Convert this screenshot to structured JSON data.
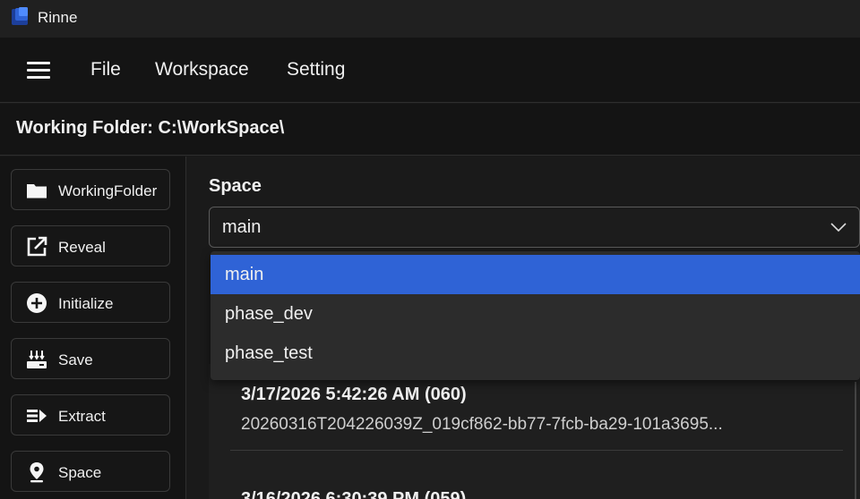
{
  "window": {
    "title": "Rinne"
  },
  "menu": {
    "items": [
      {
        "label": "File"
      },
      {
        "label": "Workspace"
      },
      {
        "label": "Setting"
      }
    ]
  },
  "working_folder": {
    "label": "Working Folder: C:\\WorkSpace\\"
  },
  "sidebar": {
    "items": [
      {
        "label": "WorkingFolder",
        "icon": "folder-icon"
      },
      {
        "label": "Reveal",
        "icon": "open-external-icon"
      },
      {
        "label": "Initialize",
        "icon": "plus-circle-icon"
      },
      {
        "label": "Save",
        "icon": "save-icon"
      },
      {
        "label": "Extract",
        "icon": "extract-icon"
      },
      {
        "label": "Space",
        "icon": "location-pin-icon"
      }
    ]
  },
  "space": {
    "label": "Space",
    "selected": "main",
    "options": [
      {
        "label": "main",
        "selected": true
      },
      {
        "label": "phase_dev",
        "selected": false
      },
      {
        "label": "phase_test",
        "selected": false
      }
    ]
  },
  "snapshots": [
    {
      "title": "3/17/2026 5:42:26 AM (060)",
      "id": "20260316T204226039Z_019cf862-bb77-7fcb-ba29-101a3695..."
    },
    {
      "title": "3/16/2026 6:30:39 PM (059)"
    }
  ],
  "colors": {
    "accent": "#2f63d6",
    "background": "#1a1a1a",
    "panel": "#141414"
  }
}
